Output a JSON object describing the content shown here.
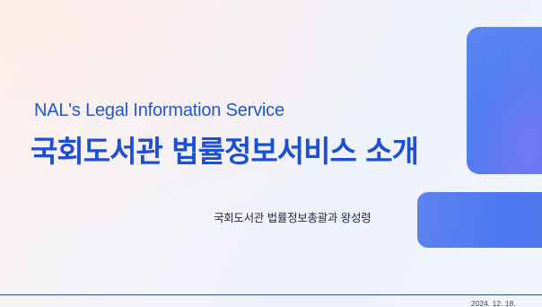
{
  "slide": {
    "subtitle": "NAL's Legal Information Service",
    "title": "국회도서관 법률정보서비스 소개",
    "author": "국회도서관 법률정보총괄과 왕성령",
    "date": "2024. 12. 18."
  },
  "colors": {
    "title": "#1c4fd3",
    "accent_block": "#4f7ef0",
    "divider": "#2c4f8f"
  }
}
